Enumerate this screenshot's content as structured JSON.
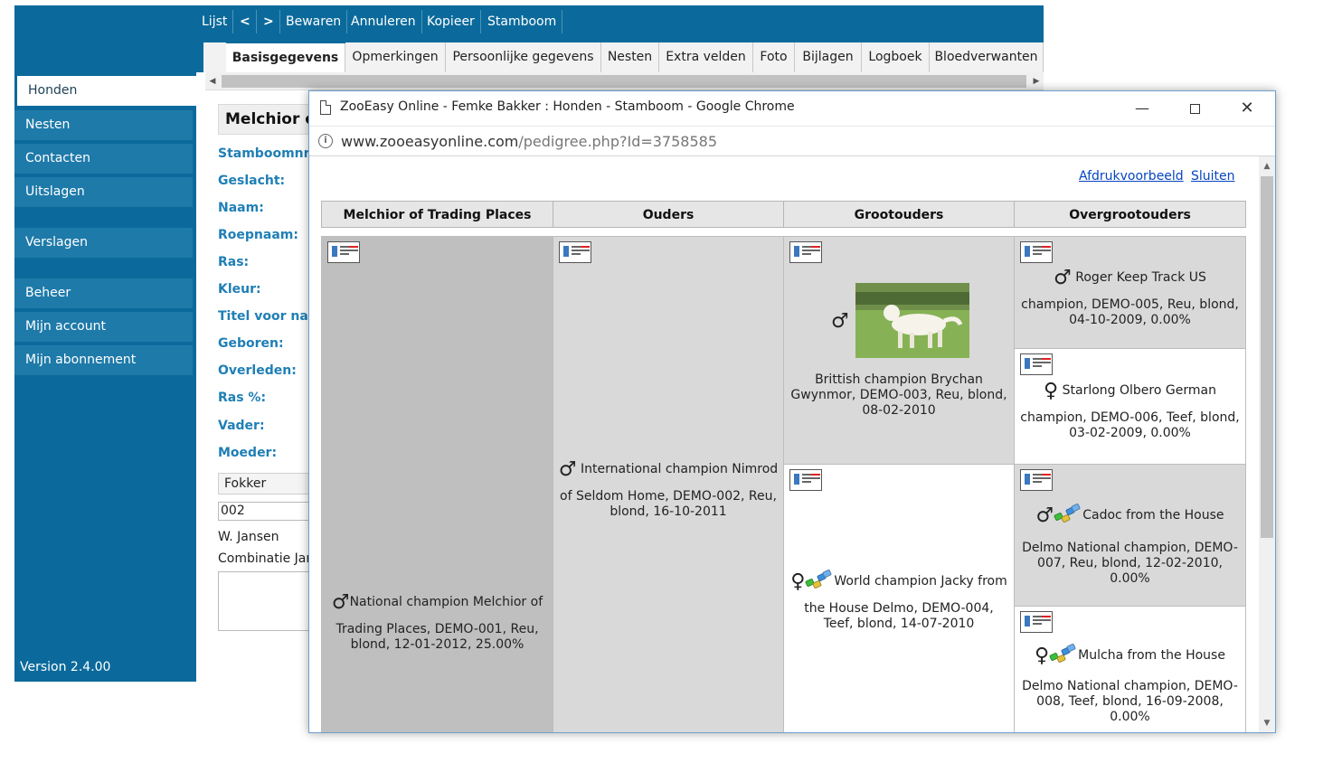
{
  "sidebar": {
    "items": [
      {
        "label": "Honden",
        "active": true
      },
      {
        "label": "Nesten"
      },
      {
        "label": "Contacten"
      },
      {
        "label": "Uitslagen"
      },
      {
        "label": "Verslagen"
      },
      {
        "label": "Beheer"
      },
      {
        "label": "Mijn account"
      },
      {
        "label": "Mijn abonnement"
      }
    ],
    "version": "Version 2.4.00"
  },
  "toolbar": {
    "lijst": "Lijst",
    "prev": "<",
    "next": ">",
    "bewaren": "Bewaren",
    "annuleren": "Annuleren",
    "kopieer": "Kopieer",
    "stamboom": "Stamboom"
  },
  "tabs": [
    {
      "label": "Basisgegevens",
      "active": true
    },
    {
      "label": "Opmerkingen"
    },
    {
      "label": "Persoonlijke gegevens"
    },
    {
      "label": "Nesten"
    },
    {
      "label": "Extra velden"
    },
    {
      "label": "Foto"
    },
    {
      "label": "Bijlagen"
    },
    {
      "label": "Logboek"
    },
    {
      "label": "Bloedverwanten"
    }
  ],
  "form": {
    "title": "Melchior o",
    "labels": {
      "stamboom": "Stamboomnr",
      "geslacht": "Geslacht:",
      "naam": "Naam:",
      "roepnaam": "Roepnaam:",
      "ras": "Ras:",
      "kleur": "Kleur:",
      "titel": "Titel voor naa",
      "geboren": "Geboren:",
      "overleden": "Overleden:",
      "ras_pct": "Ras %:",
      "vader": "Vader:",
      "moeder": "Moeder:"
    },
    "fokker_select": "Fokker",
    "code_value": "002",
    "breeder_name": "W. Jansen",
    "combination": "Combinatie Jar"
  },
  "popup": {
    "window_title": "ZooEasy Online - Femke Bakker : Honden - Stamboom - Google Chrome",
    "url_host": "www.zooeasyonline.com",
    "url_path": "/pedigree.php?Id=3758585",
    "links": {
      "print_preview": "Afdrukvoorbeeld",
      "close": "Sluiten"
    },
    "columns": [
      "Melchior of Trading Places",
      "Ouders",
      "Grootouders",
      "Overgrootouders"
    ],
    "dogs": {
      "subject": {
        "line1": "National champion Melchior of",
        "rest": "Trading Places, DEMO-001, Reu, blond, 12-01-2012, 25.00%"
      },
      "sire": {
        "line1": "International champion Nimrod",
        "rest": "of Seldom Home, DEMO-002, Reu, blond, 16-10-2011"
      },
      "gp_sire": {
        "text": "Brittish champion Brychan Gwynmor, DEMO-003, Reu, blond, 08-02-2010"
      },
      "gp_dam": {
        "line1": "World champion Jacky from",
        "rest": "the House Delmo, DEMO-004, Teef, blond, 14-07-2010"
      },
      "ggp1": {
        "line1": "Roger Keep Track US",
        "rest": "champion, DEMO-005, Reu, blond, 04-10-2009, 0.00%"
      },
      "ggp2": {
        "line1": "Starlong Olbero German",
        "rest": "champion, DEMO-006, Teef, blond, 03-02-2009, 0.00%"
      },
      "ggp3": {
        "line1": "Cadoc from the House",
        "rest": "Delmo National champion, DEMO-007, Reu, blond, 12-02-2010, 0.00%"
      },
      "ggp4": {
        "line1": "Mulcha from the House",
        "rest": "Delmo National champion, DEMO-008, Teef, blond, 16-09-2008, 0.00%"
      }
    }
  },
  "colors": {
    "sidebar_bg": "#0b6a9b",
    "sidebar_item": "#1e7aa9",
    "field_label": "#1f7fb6",
    "link": "#0645c0",
    "male_cell": "#d9d9d9",
    "subject_cell": "#bfbfbf"
  }
}
